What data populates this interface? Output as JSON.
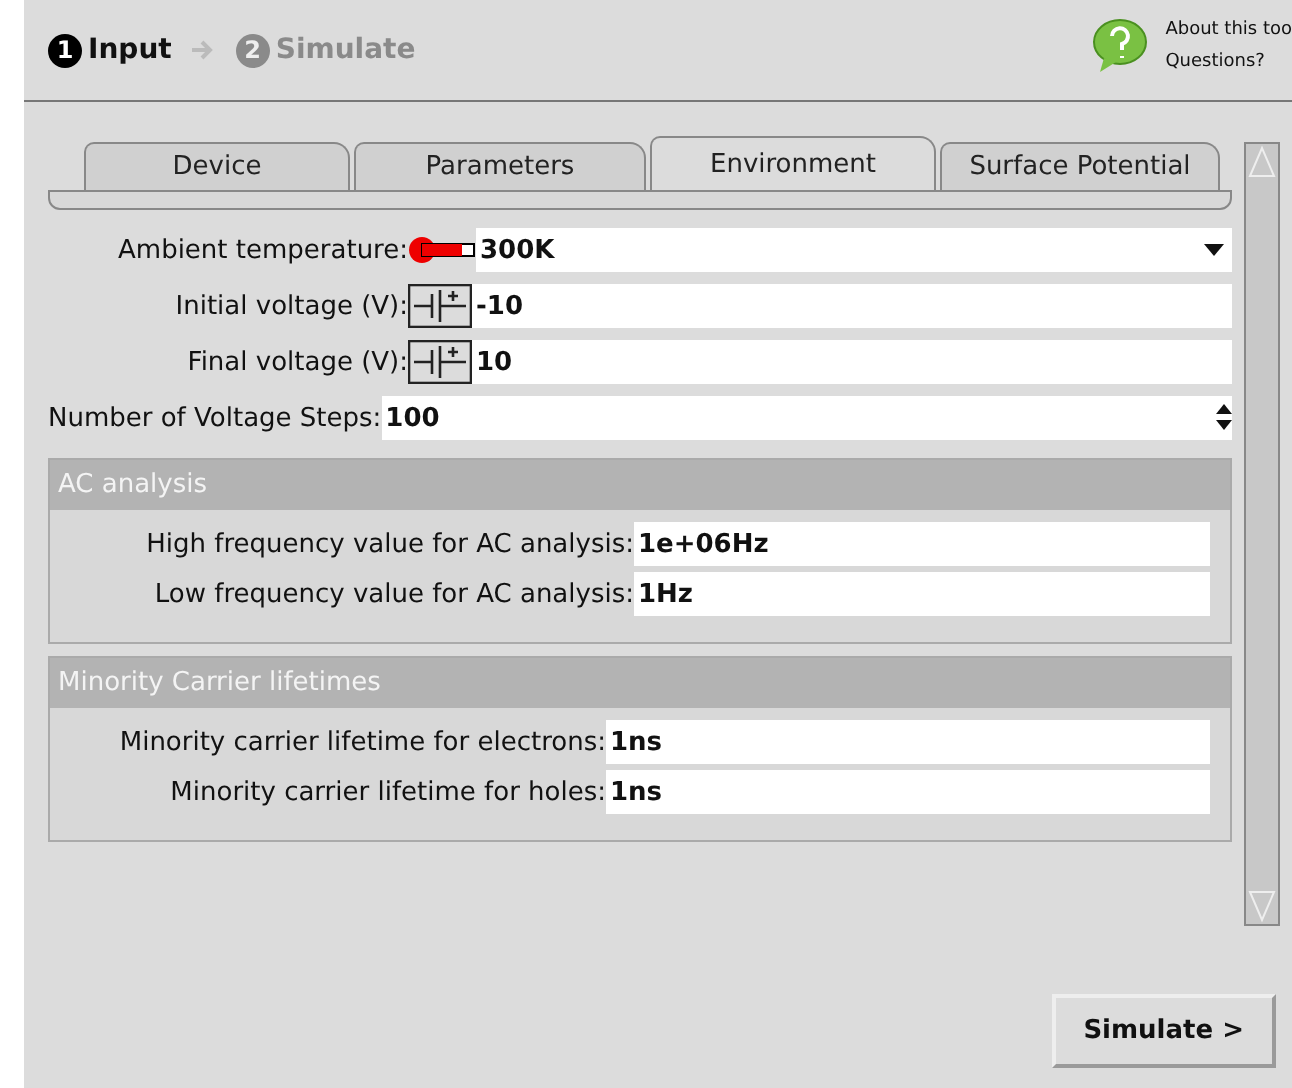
{
  "steps": [
    {
      "number": "1",
      "label": "Input",
      "selected": true
    },
    {
      "number": "2",
      "label": "Simulate",
      "selected": false
    }
  ],
  "help": {
    "about": "About this too",
    "questions": "Questions?"
  },
  "tabs": [
    {
      "label": "Device",
      "selected": false
    },
    {
      "label": "Parameters",
      "selected": false
    },
    {
      "label": "Environment",
      "selected": true
    },
    {
      "label": "Surface Potential",
      "selected": false
    }
  ],
  "fields": [
    {
      "kind": "temperature",
      "label": "Ambient temperature:",
      "value": "300K"
    },
    {
      "kind": "voltage",
      "label": "Initial voltage (V):",
      "value": "-10"
    },
    {
      "kind": "voltage",
      "label": "Final voltage (V):",
      "value": "10"
    },
    {
      "kind": "spinner",
      "label": "Number of Voltage Steps:",
      "value": "100"
    }
  ],
  "sections": [
    {
      "title": "AC analysis",
      "fields": [
        {
          "label": "High frequency value for AC analysis:",
          "value": "1e+06Hz"
        },
        {
          "label": "Low frequency value for AC analysis:",
          "value": "1Hz"
        }
      ]
    },
    {
      "title": "Minority Carrier lifetimes",
      "fields": [
        {
          "label": "Minority carrier lifetime for electrons:",
          "value": "1ns"
        },
        {
          "label": "Minority carrier lifetime for holes:",
          "value": "1ns"
        }
      ]
    }
  ],
  "button": "Simulate >"
}
